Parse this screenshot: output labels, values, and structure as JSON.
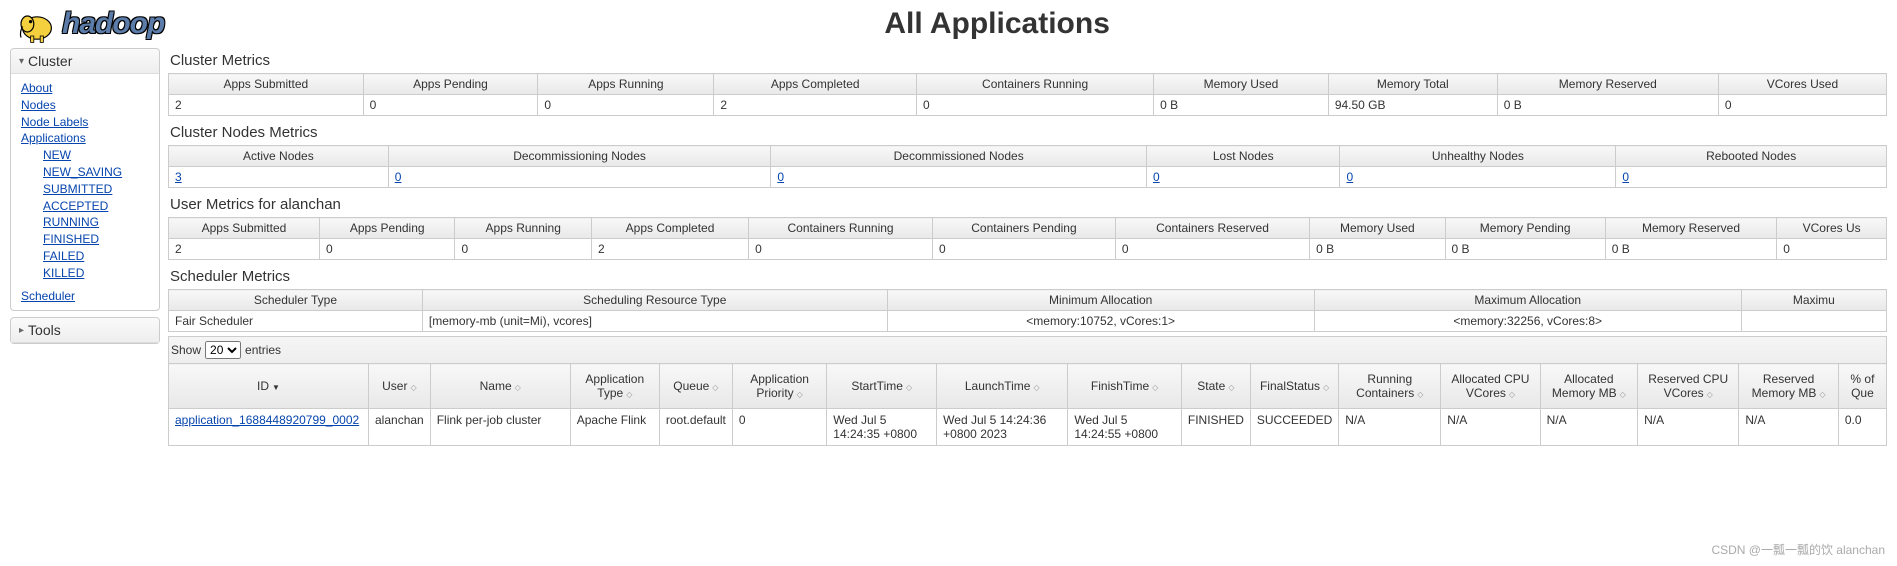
{
  "header": {
    "logo_text": "hadoop",
    "title": "All Applications"
  },
  "sidebar": {
    "cluster": {
      "label": "Cluster",
      "links": {
        "about": "About",
        "nodes": "Nodes",
        "node_labels": "Node Labels",
        "applications": "Applications",
        "new": "NEW",
        "new_saving": "NEW_SAVING",
        "submitted": "SUBMITTED",
        "accepted": "ACCEPTED",
        "running": "RUNNING",
        "finished": "FINISHED",
        "failed": "FAILED",
        "killed": "KILLED",
        "scheduler": "Scheduler"
      }
    },
    "tools": {
      "label": "Tools"
    }
  },
  "cluster_metrics": {
    "title": "Cluster Metrics",
    "headers": [
      "Apps Submitted",
      "Apps Pending",
      "Apps Running",
      "Apps Completed",
      "Containers Running",
      "Memory Used",
      "Memory Total",
      "Memory Reserved",
      "VCores Used"
    ],
    "values": [
      "2",
      "0",
      "0",
      "2",
      "0",
      "0 B",
      "94.50 GB",
      "0 B",
      "0"
    ]
  },
  "nodes_metrics": {
    "title": "Cluster Nodes Metrics",
    "headers": [
      "Active Nodes",
      "Decommissioning Nodes",
      "Decommissioned Nodes",
      "Lost Nodes",
      "Unhealthy Nodes",
      "Rebooted Nodes"
    ],
    "values": [
      "3",
      "0",
      "0",
      "0",
      "0",
      "0"
    ]
  },
  "user_metrics": {
    "title": "User Metrics for alanchan",
    "headers": [
      "Apps Submitted",
      "Apps Pending",
      "Apps Running",
      "Apps Completed",
      "Containers Running",
      "Containers Pending",
      "Containers Reserved",
      "Memory Used",
      "Memory Pending",
      "Memory Reserved",
      "VCores Us"
    ],
    "values": [
      "2",
      "0",
      "0",
      "2",
      "0",
      "0",
      "0",
      "0 B",
      "0 B",
      "0 B",
      "0"
    ]
  },
  "scheduler_metrics": {
    "title": "Scheduler Metrics",
    "headers": [
      "Scheduler Type",
      "Scheduling Resource Type",
      "Minimum Allocation",
      "Maximum Allocation",
      "Maximu"
    ],
    "values": [
      "Fair Scheduler",
      "[memory-mb (unit=Mi), vcores]",
      "<memory:10752, vCores:1>",
      "<memory:32256, vCores:8>",
      ""
    ]
  },
  "entries": {
    "show_label": "Show",
    "entries_label": "entries",
    "count": "20"
  },
  "app_table": {
    "headers": [
      "ID",
      "User",
      "Name",
      "Application Type",
      "Queue",
      "Application Priority",
      "StartTime",
      "LaunchTime",
      "FinishTime",
      "State",
      "FinalStatus",
      "Running Containers",
      "Allocated CPU VCores",
      "Allocated Memory MB",
      "Reserved CPU VCores",
      "Reserved Memory MB",
      "% of Que"
    ],
    "row": {
      "id": "application_1688448920799_0002",
      "user": "alanchan",
      "name": "Flink per-job cluster",
      "type": "Apache Flink",
      "queue": "root.default",
      "priority": "0",
      "start": "Wed Jul 5 14:24:35 +0800",
      "launch": "Wed Jul 5 14:24:36 +0800 2023",
      "finish": "Wed Jul 5 14:24:55 +0800",
      "state": "FINISHED",
      "final": "SUCCEEDED",
      "containers": "N/A",
      "cpu": "N/A",
      "mem": "N/A",
      "rcpu": "N/A",
      "rmem": "N/A",
      "pct": "0.0"
    }
  },
  "watermark": "CSDN @一瓢一瓢的饮 alanchan"
}
